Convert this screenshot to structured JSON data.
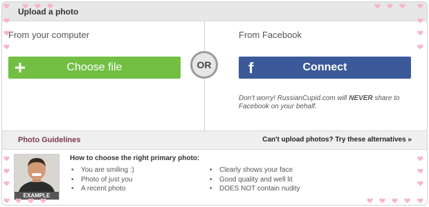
{
  "header": {
    "title": "Upload a photo"
  },
  "computer": {
    "label": "From your computer",
    "button_label": "Choose file"
  },
  "separator": {
    "label": "OR"
  },
  "facebook": {
    "label": "From Facebook",
    "button_label": "Connect",
    "note_prefix": "Don't worry! RussianCupid.com will ",
    "note_emphasis": "NEVER",
    "note_suffix": " share to Facebook on your behalf."
  },
  "guidelines": {
    "title": "Photo Guidelines",
    "alternatives_link": "Can't upload photos? Try these alternatives »",
    "example_caption": "EXAMPLE",
    "heading": "How to choose the right primary photo:",
    "left_items": [
      "You are smiling :)",
      "Photo of just you",
      "A recent photo"
    ],
    "right_items": [
      "Clearly shows your face",
      "Good quality and well lit",
      "DOES NOT contain nudity"
    ]
  },
  "colors": {
    "choose_file_green": "#72bf44",
    "facebook_blue": "#3c5a9a",
    "heart_pink": "#f6b6c6",
    "guidelines_title": "#7a3a4a"
  },
  "icons": {
    "plus": "plus-icon",
    "facebook": "facebook-icon",
    "heart": "heart-icon"
  }
}
